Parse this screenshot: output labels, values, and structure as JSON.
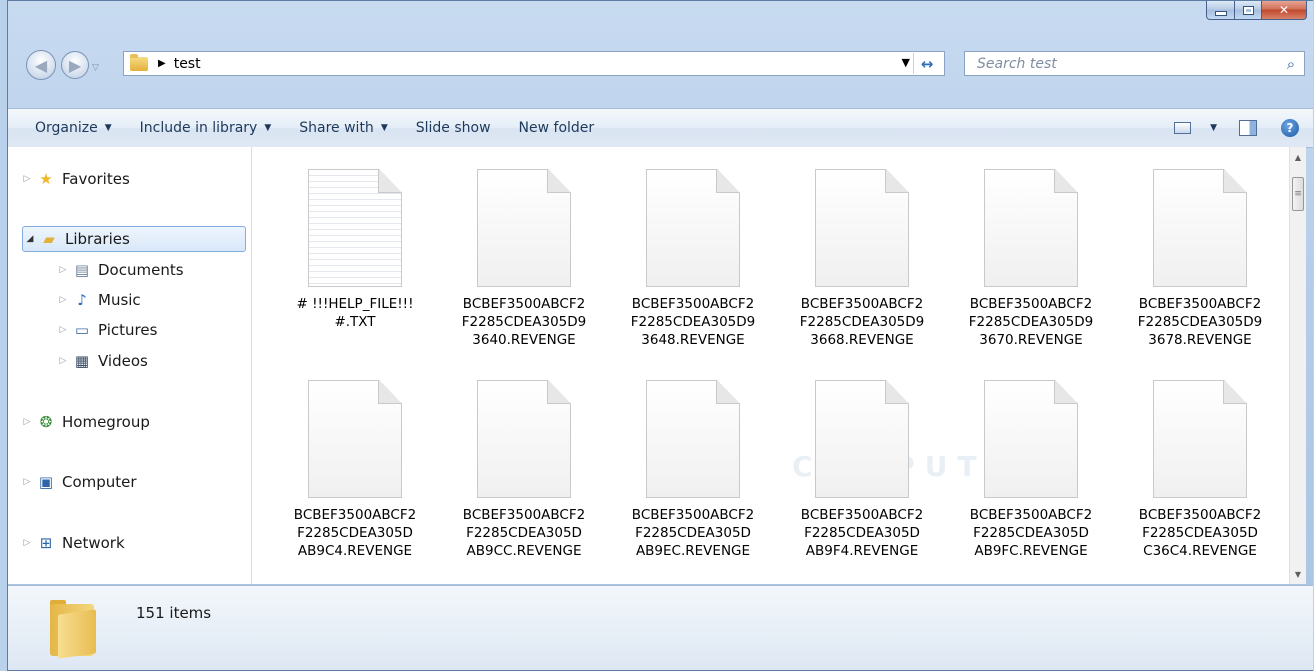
{
  "window": {
    "caption": {
      "minimize": "",
      "maximize": "",
      "close": "✕"
    }
  },
  "address_bar": {
    "crumb_arrow": "▶",
    "path": "test",
    "dropdown": "▼",
    "refresh": "↔"
  },
  "search": {
    "placeholder": "Search test",
    "icon": "search-icon"
  },
  "toolbar": {
    "organize": "Organize",
    "include_in_library": "Include in library",
    "share_with": "Share with",
    "slide_show": "Slide show",
    "new_folder": "New folder",
    "caret": "▼",
    "help": "?"
  },
  "nav_pane": {
    "favorites": "Favorites",
    "libraries": "Libraries",
    "documents": "Documents",
    "music": "Music",
    "pictures": "Pictures",
    "videos": "Videos",
    "homegroup": "Homegroup",
    "computer": "Computer",
    "network": "Network",
    "collapsed_arrow": "▷",
    "expanded_arrow": "◢"
  },
  "files": [
    {
      "name": "# !!!HELP_FILE!!! #.TXT",
      "type": "txt"
    },
    {
      "name": "BCBEF3500ABCF2F2285CDEA305D93640.REVENGE",
      "type": "blank"
    },
    {
      "name": "BCBEF3500ABCF2F2285CDEA305D93648.REVENGE",
      "type": "blank"
    },
    {
      "name": "BCBEF3500ABCF2F2285CDEA305D93668.REVENGE",
      "type": "blank"
    },
    {
      "name": "BCBEF3500ABCF2F2285CDEA305D93670.REVENGE",
      "type": "blank"
    },
    {
      "name": "BCBEF3500ABCF2F2285CDEA305D93678.REVENGE",
      "type": "blank"
    },
    {
      "name": "BCBEF3500ABCF2F2285CDEA305DAB9C4.REVENGE",
      "type": "blank"
    },
    {
      "name": "BCBEF3500ABCF2F2285CDEA305DAB9CC.REVENGE",
      "type": "blank"
    },
    {
      "name": "BCBEF3500ABCF2F2285CDEA305DAB9EC.REVENGE",
      "type": "blank"
    },
    {
      "name": "BCBEF3500ABCF2F2285CDEA305DAB9F4.REVENGE",
      "type": "blank"
    },
    {
      "name": "BCBEF3500ABCF2F2285CDEA305DAB9FC.REVENGE",
      "type": "blank"
    },
    {
      "name": "BCBEF3500ABCF2F2285CDEA305DC36C4.REVENGE",
      "type": "blank"
    }
  ],
  "file_name_lines": [
    [
      "# !!!HELP_FILE!!!",
      "#.TXT"
    ],
    [
      "BCBEF3500ABCF2",
      "F2285CDEA305D9",
      "3640.REVENGE"
    ],
    [
      "BCBEF3500ABCF2",
      "F2285CDEA305D9",
      "3648.REVENGE"
    ],
    [
      "BCBEF3500ABCF2",
      "F2285CDEA305D9",
      "3668.REVENGE"
    ],
    [
      "BCBEF3500ABCF2",
      "F2285CDEA305D9",
      "3670.REVENGE"
    ],
    [
      "BCBEF3500ABCF2",
      "F2285CDEA305D9",
      "3678.REVENGE"
    ],
    [
      "BCBEF3500ABCF2",
      "F2285CDEA305D",
      "AB9C4.REVENGE"
    ],
    [
      "BCBEF3500ABCF2",
      "F2285CDEA305D",
      "AB9CC.REVENGE"
    ],
    [
      "BCBEF3500ABCF2",
      "F2285CDEA305D",
      "AB9EC.REVENGE"
    ],
    [
      "BCBEF3500ABCF2",
      "F2285CDEA305D",
      "AB9F4.REVENGE"
    ],
    [
      "BCBEF3500ABCF2",
      "F2285CDEA305D",
      "AB9FC.REVENGE"
    ],
    [
      "BCBEF3500ABCF2",
      "F2285CDEA305D",
      "C36C4.REVENGE"
    ]
  ],
  "details_pane": {
    "item_count": "151 items"
  },
  "watermark": "COMPUTER",
  "colors": {
    "chrome": "#b9d1ea",
    "selection_border": "#84acdd",
    "link_text": "#1e395b"
  }
}
